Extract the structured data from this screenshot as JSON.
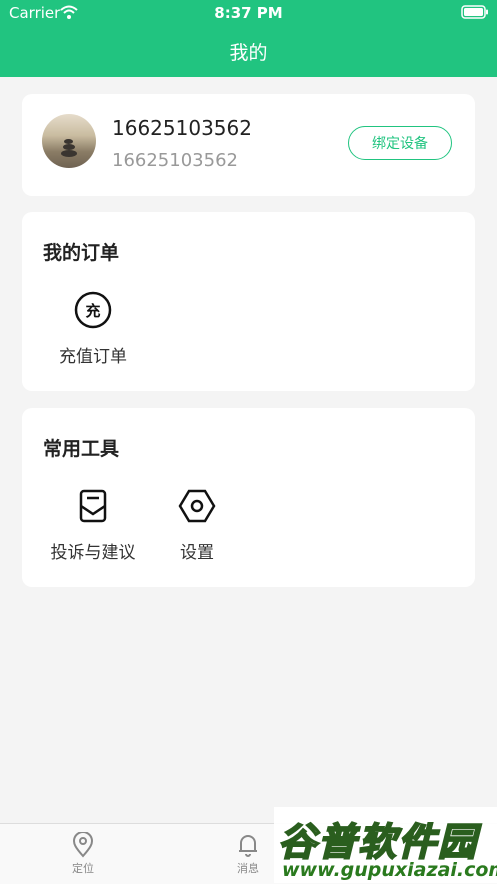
{
  "status_bar": {
    "carrier": "Carrier",
    "time": "8:37 PM"
  },
  "header": {
    "title": "我的"
  },
  "profile": {
    "name": "16625103562",
    "phone": "16625103562",
    "bind_label": "绑定设备"
  },
  "orders": {
    "title": "我的订单",
    "items": [
      {
        "label": "充值订单",
        "icon_glyph": "充",
        "icon": "recharge-icon"
      }
    ]
  },
  "tools": {
    "title": "常用工具",
    "items": [
      {
        "label": "投诉与建议",
        "icon": "feedback-icon"
      },
      {
        "label": "设置",
        "icon": "settings-icon"
      }
    ]
  },
  "tabbar": {
    "items": [
      {
        "label": "定位",
        "icon": "location-pin-icon"
      },
      {
        "label": "消息",
        "icon": "bell-icon"
      }
    ]
  },
  "watermark": {
    "title": "谷普软件园",
    "url": "www.gupuxiazai.com"
  },
  "colors": {
    "brand": "#21c480",
    "background": "#f4f4f4",
    "card": "#ffffff"
  }
}
